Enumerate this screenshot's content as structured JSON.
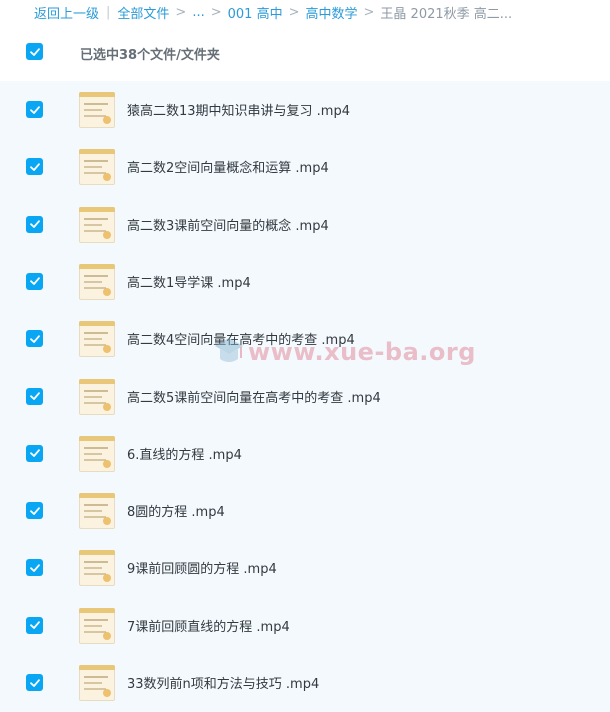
{
  "breadcrumb": {
    "back": "返回上一级",
    "separator_pipe": "|",
    "items": [
      "全部文件",
      "...",
      "001 高中",
      "高中数学"
    ],
    "current": "王晶 2021秋季 高二...",
    "separator": ">"
  },
  "selection": {
    "label": "已选中38个文件/文件夹"
  },
  "files": [
    {
      "name": "猿高二数13期中知识串讲与复习 .mp4",
      "checked": true
    },
    {
      "name": "高二数2空间向量概念和运算 .mp4",
      "checked": true
    },
    {
      "name": "高二数3课前空间向量的概念 .mp4",
      "checked": true
    },
    {
      "name": "高二数1导学课 .mp4",
      "checked": true
    },
    {
      "name": "高二数4空间向量在高考中的考查 .mp4",
      "checked": true
    },
    {
      "name": "高二数5课前空间向量在高考中的考查 .mp4",
      "checked": true
    },
    {
      "name": "6.直线的方程 .mp4",
      "checked": true
    },
    {
      "name": "8圆的方程 .mp4",
      "checked": true
    },
    {
      "name": "9课前回顾圆的方程 .mp4",
      "checked": true
    },
    {
      "name": "7课前回顾直线的方程 .mp4",
      "checked": true
    },
    {
      "name": "33数列前n项和方法与技巧 .mp4",
      "checked": true
    }
  ],
  "watermark": "www.xue-ba.org",
  "colors": {
    "accent": "#09a6f3",
    "link": "#2a9bd8",
    "list_bg": "#f3f9fd"
  }
}
